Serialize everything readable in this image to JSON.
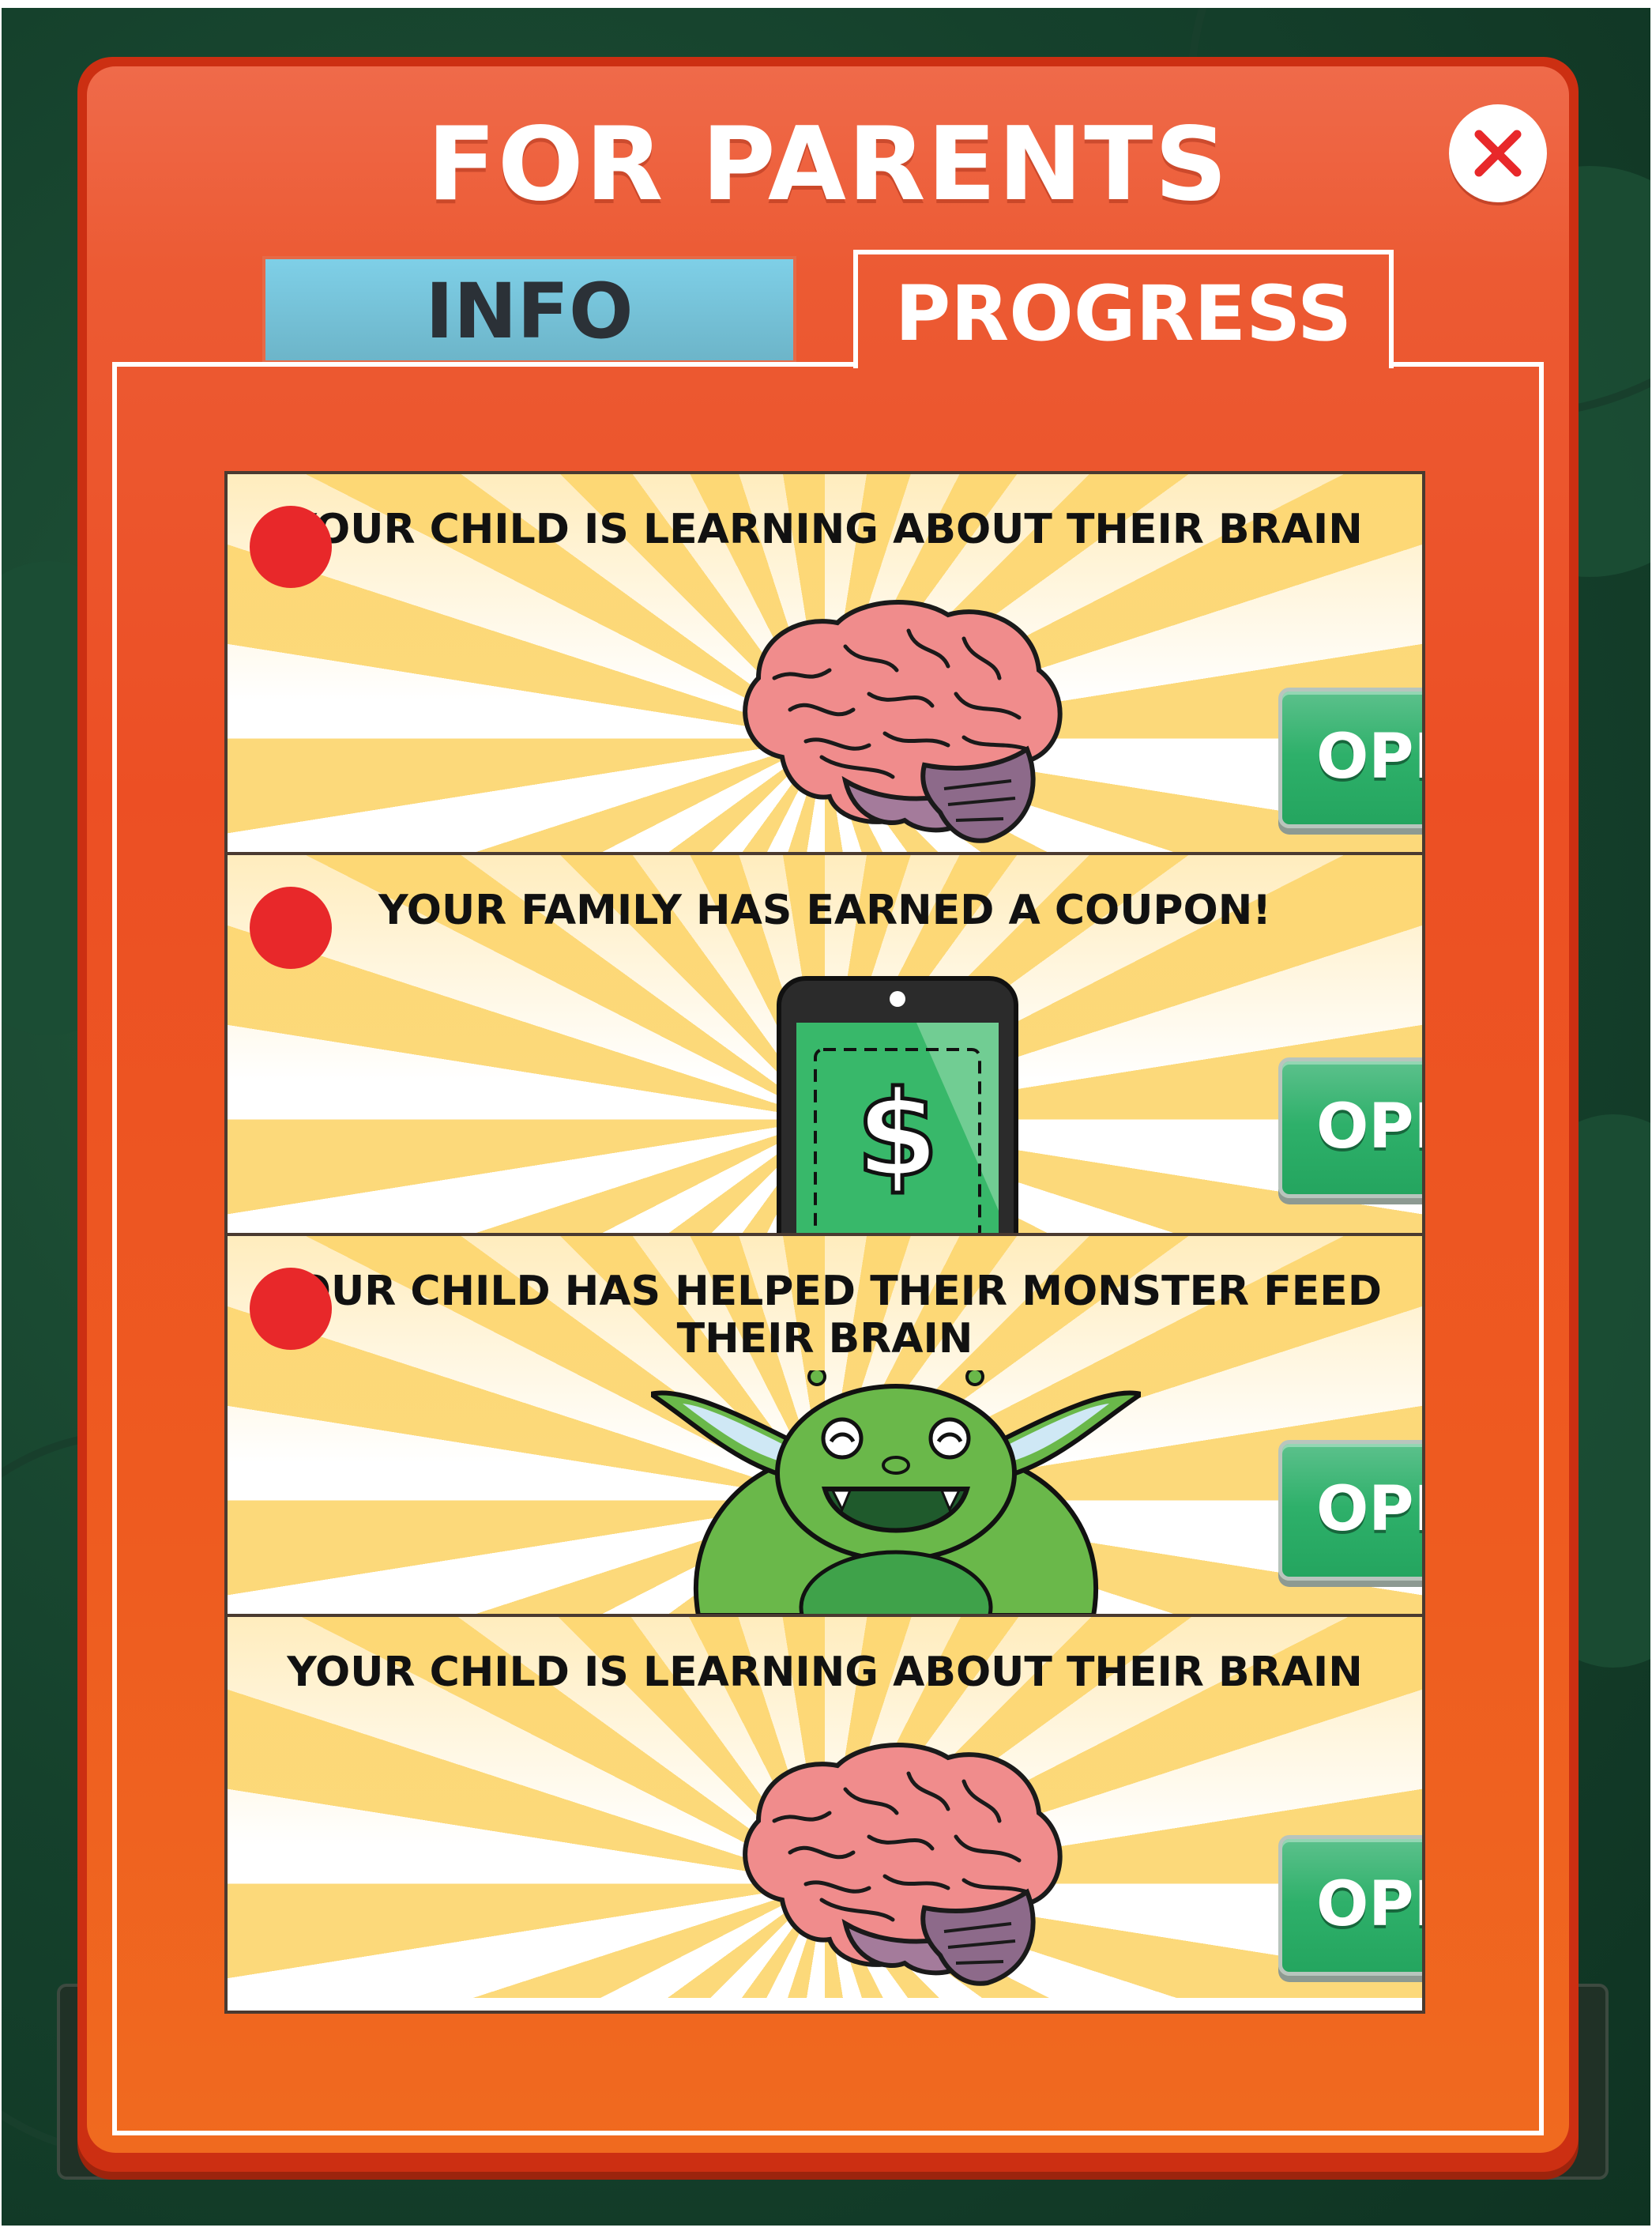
{
  "dialog": {
    "title": "FOR PARENTS",
    "close_icon": "close-x-icon",
    "colors": {
      "frame": "#cc2f12",
      "accent_red": "#e8282a",
      "open_green": "#2eb06a",
      "info_tab": "#7fd0e8"
    }
  },
  "tabs": [
    {
      "label": "INFO",
      "active": false
    },
    {
      "label": "PROGRESS",
      "active": true
    }
  ],
  "progress_items": [
    {
      "text": "YOUR CHILD IS LEARNING ABOUT THEIR BRAIN",
      "image": "brain",
      "unread": true,
      "button": "OPEN"
    },
    {
      "text": "YOUR FAMILY HAS EARNED A COUPON!",
      "image": "phone-coupon",
      "unread": true,
      "button": "OPEN"
    },
    {
      "text": "YOUR CHILD HAS HELPED THEIR MONSTER FEED THEIR BRAIN",
      "image": "green-monster",
      "unread": true,
      "button": "OPEN"
    },
    {
      "text": "YOUR CHILD IS LEARNING ABOUT THEIR BRAIN",
      "image": "brain",
      "unread": false,
      "button": "OPEN"
    }
  ]
}
